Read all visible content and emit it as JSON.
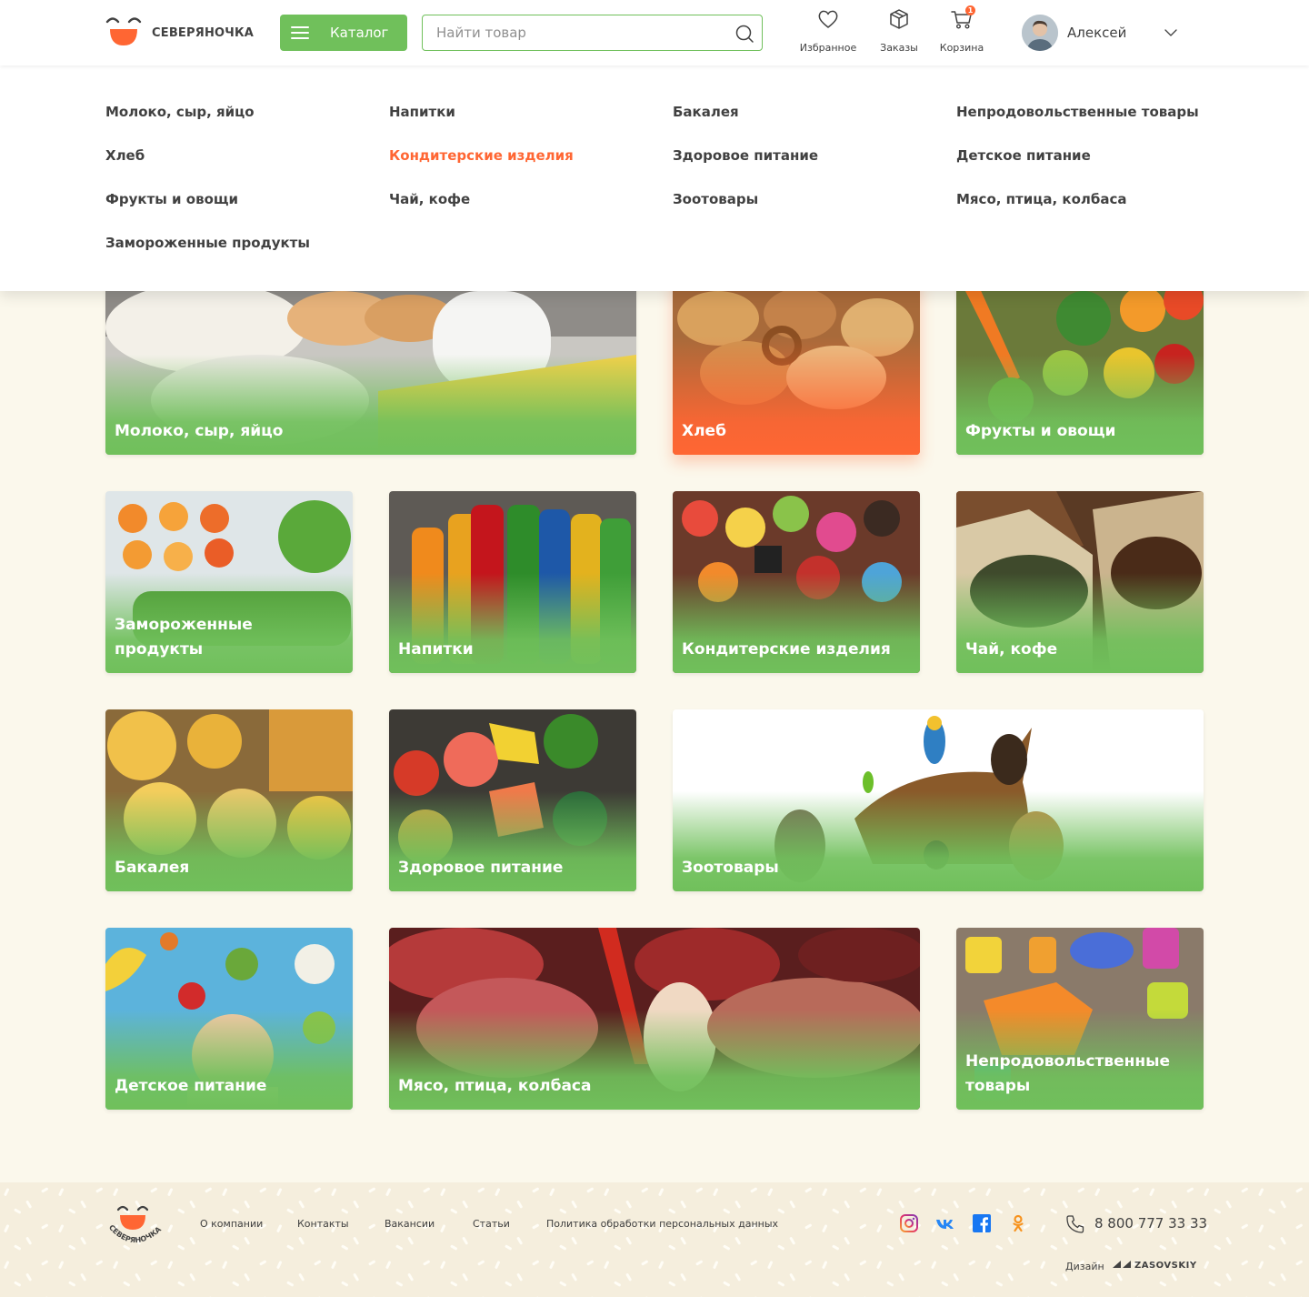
{
  "brand": {
    "name": "СЕВЕРЯНОЧКА",
    "accent": "#70c05b",
    "secondary": "#ff6633"
  },
  "header": {
    "catalog_label": "Каталог",
    "search_placeholder": "Найти товар",
    "favorites_label": "Избранное",
    "orders_label": "Заказы",
    "cart_label": "Корзина",
    "cart_count": "1",
    "user_name": "Алексей"
  },
  "menu": {
    "col1": [
      "Молоко, сыр, яйцо",
      "Хлеб",
      "Фрукты и овощи",
      "Замороженные продукты"
    ],
    "col2": [
      "Напитки",
      "Кондитерские изделия",
      "Чай, кофе"
    ],
    "col3": [
      "Бакалея",
      "Здоровое питание",
      "Зоотовары"
    ],
    "col4": [
      "Непродовольственные товары",
      "Детское питание",
      "Мясо, птица, колбаса"
    ],
    "active": "Кондитерские изделия"
  },
  "categories": [
    {
      "label": "Молоко, сыр, яйцо",
      "icon": "dairy-image"
    },
    {
      "label": "Хлеб",
      "icon": "bread-image",
      "highlighted": true
    },
    {
      "label": "Фрукты и овощи",
      "icon": "vegetables-image"
    },
    {
      "label": "Замороженные продукты",
      "icon": "frozen-image"
    },
    {
      "label": "Напитки",
      "icon": "drinks-image"
    },
    {
      "label": "Кондитерские изделия",
      "icon": "sweets-image"
    },
    {
      "label": "Чай, кофе",
      "icon": "tea-coffee-image"
    },
    {
      "label": "Бакалея",
      "icon": "pasta-image"
    },
    {
      "label": "Здоровое питание",
      "icon": "healthy-food-image"
    },
    {
      "label": "Зоотовары",
      "icon": "pets-image"
    },
    {
      "label": "Детское питание",
      "icon": "baby-food-image"
    },
    {
      "label": "Мясо, птица, колбаса",
      "icon": "meat-image"
    },
    {
      "label": "Непродовольственные товары",
      "icon": "household-image"
    }
  ],
  "footer": {
    "links": [
      "О компании",
      "Контакты",
      "Вакансии",
      "Статьи",
      "Политика обработки персональных данных"
    ],
    "socials": [
      "instagram-icon",
      "vk-icon",
      "facebook-icon",
      "odnoklassniki-icon"
    ],
    "phone": "8 800 777 33 33",
    "design_label": "Дизайн",
    "design_brand": "ZASOVSKIY"
  }
}
